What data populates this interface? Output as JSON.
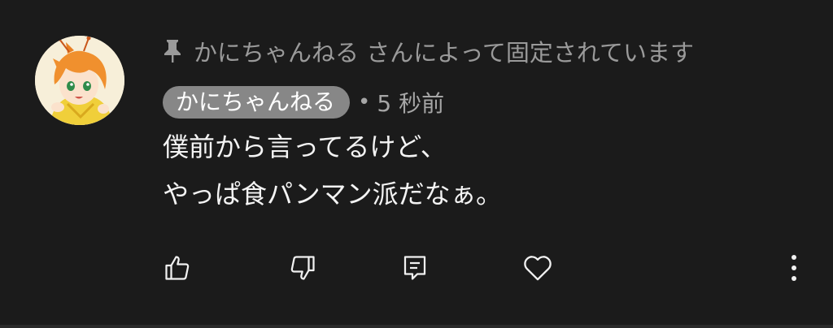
{
  "comment": {
    "pinned_text": "かにちゃんねる さんによって固定されています",
    "author": "かにちゃんねる",
    "separator": "•",
    "time": "5 秒前",
    "body_lines": [
      "僕前から言ってるけど、",
      "やっぱ食パンマン派だなぁ。"
    ]
  },
  "icons": {
    "pin": "pin-icon",
    "like": "thumbs-up-icon",
    "dislike": "thumbs-down-icon",
    "reply": "comment-icon",
    "heart": "heart-icon",
    "more": "more-vertical-icon"
  },
  "colors": {
    "background": "#1b1b1b",
    "badge_bg": "#878787",
    "muted_text": "#9a9a9a",
    "body_text": "#f4f4f4"
  }
}
